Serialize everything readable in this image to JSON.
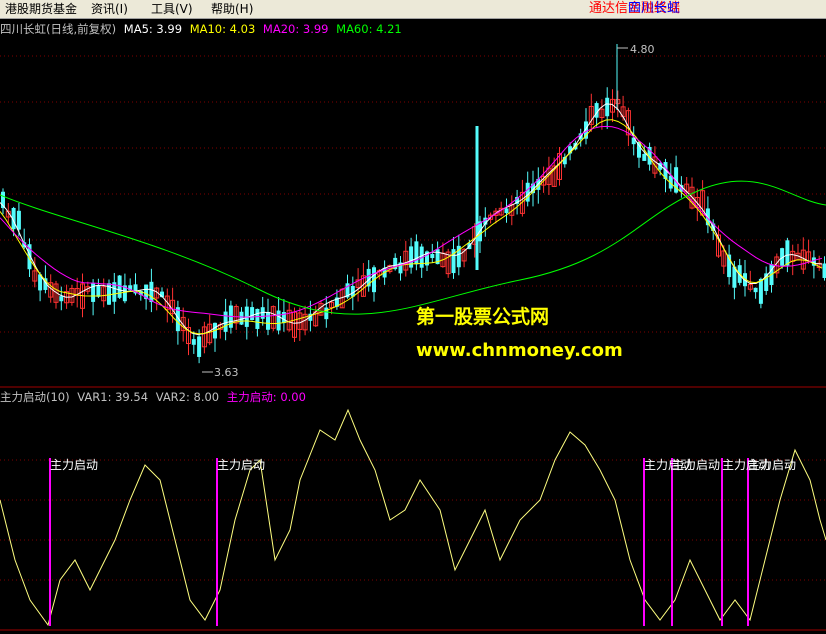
{
  "menubar": {
    "items": [
      "港股期货基金",
      "资讯(I)",
      "工具(V)",
      "帮助(H)"
    ],
    "app_title": "通达信金融终端",
    "stock_name": "四川长虹"
  },
  "main_chart": {
    "legend": {
      "title": "四川长虹(日线,前复权)",
      "ma5": "MA5: 3.99",
      "ma10": "MA10: 4.03",
      "ma20": "MA20: 3.99",
      "ma60": "MA60: 4.21"
    },
    "high_label": "4.80",
    "low_label": "3.63"
  },
  "indicator": {
    "legend": {
      "title": "主力启动(10)",
      "var1": "VAR1: 39.54",
      "var2": "VAR2: 8.00",
      "signal": "主力启动: 0.00"
    },
    "signal_label": "主力启动"
  },
  "watermark": {
    "line1": "第一股票公式网",
    "line2": "www.chnmoney.com"
  },
  "colors": {
    "bg": "#000000",
    "up": "#ff3232",
    "down": "#54fcfc",
    "ma5": "#ffffff",
    "ma10": "#ffff00",
    "ma20": "#ff00ff",
    "ma60": "#00ff00",
    "var_line": "#ffff80",
    "signal": "#ff00ff",
    "grid": "#800000"
  },
  "chart_data": {
    "type": "candlestick",
    "visible_price_high": 4.8,
    "visible_price_low": 3.63,
    "ma_values": {
      "MA5": 3.99,
      "MA10": 4.03,
      "MA20": 3.99,
      "MA60": 4.21
    },
    "indicator_values": {
      "VAR1": 39.54,
      "VAR2": 8.0,
      "主力启动": 0.0
    }
  }
}
